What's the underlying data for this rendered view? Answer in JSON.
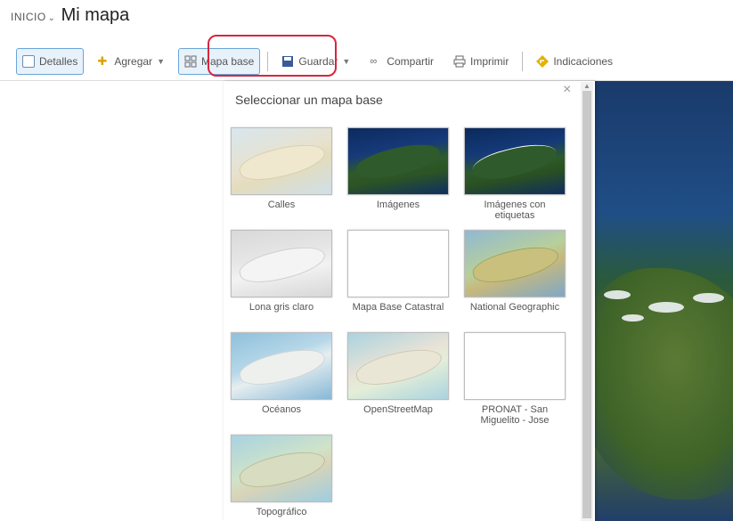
{
  "header": {
    "breadcrumb": "INICIO",
    "title": "Mi mapa"
  },
  "toolbar": {
    "details": "Detalles",
    "add": "Agregar",
    "basemap": "Mapa base",
    "save": "Guardar",
    "share": "Compartir",
    "print": "Imprimir",
    "directions": "Indicaciones"
  },
  "panel": {
    "title": "Seleccionar un mapa base",
    "close": "×",
    "basemaps": [
      {
        "label": "Calles"
      },
      {
        "label": "Imágenes"
      },
      {
        "label": "Imágenes con etiquetas"
      },
      {
        "label": "Lona gris claro"
      },
      {
        "label": "Mapa Base Catastral"
      },
      {
        "label": "National Geographic"
      },
      {
        "label": "Océanos"
      },
      {
        "label": "OpenStreetMap"
      },
      {
        "label": "PRONAT - San Miguelito - Jose"
      },
      {
        "label": "Topográfico"
      }
    ]
  },
  "colors": {
    "highlight": "#d7263d",
    "active_border": "#6aa5d8",
    "active_bg": "#e8f2fb"
  }
}
